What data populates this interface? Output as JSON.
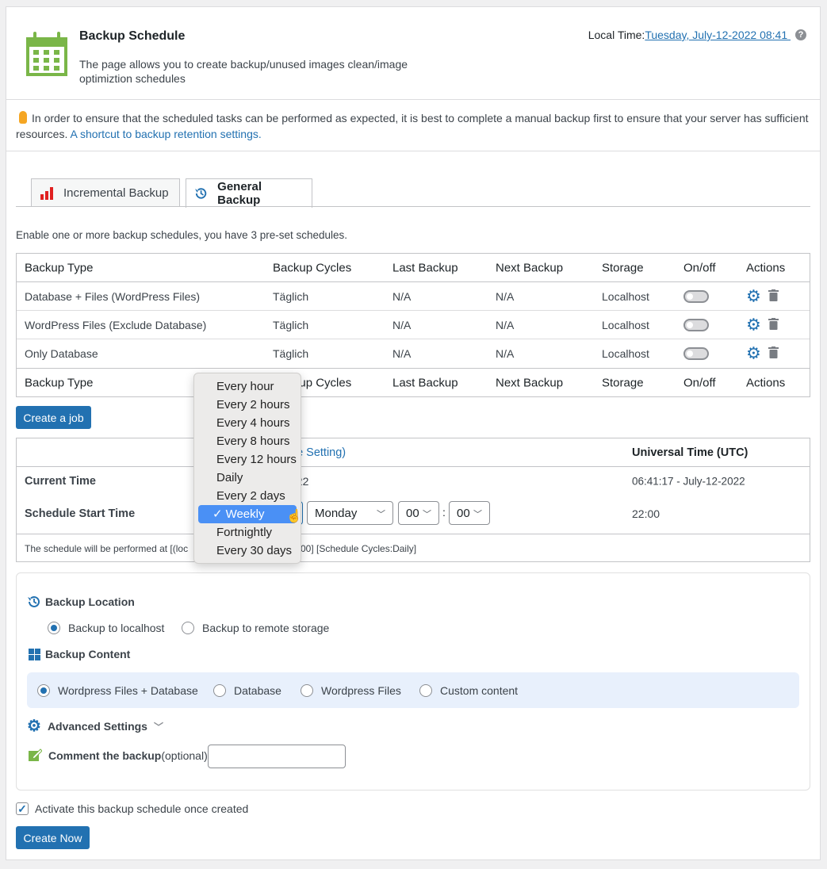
{
  "header": {
    "title": "Backup Schedule",
    "description_line1": "The page allows you to create backup/unused images clean/image",
    "description_line2": "optimiztion schedules",
    "local_time_label": "Local Time: ",
    "local_time_value": "Tuesday, July-12-2022 08:41 ",
    "help_icon": "?"
  },
  "notice": {
    "text": "In order to ensure that the scheduled tasks can be performed as expected, it is best to complete a manual backup first to ensure that your server has sufficient resources. ",
    "link": "A shortcut to backup retention settings."
  },
  "tabs": [
    {
      "label": "Incremental Backup",
      "icon": "bar-chart-icon"
    },
    {
      "label": "General Backup",
      "icon": "history-icon",
      "active": true
    }
  ],
  "intro": "Enable one or more backup schedules, you have 3 pre-set schedules.",
  "schedules_table": {
    "columns": [
      "Backup Type",
      "Backup Cycles",
      "Last Backup",
      "Next Backup",
      "Storage",
      "On/off",
      "Actions"
    ],
    "rows": [
      {
        "type": "Database + Files (WordPress Files)",
        "cycle": "Täglich",
        "last": "N/A",
        "next": "N/A",
        "storage": "Localhost",
        "on": false
      },
      {
        "type": "WordPress Files (Exclude Database)",
        "cycle": "Täglich",
        "last": "N/A",
        "next": "N/A",
        "storage": "Localhost",
        "on": false
      },
      {
        "type": "Only Database",
        "cycle": "Täglich",
        "last": "N/A",
        "next": "N/A",
        "storage": "Localhost",
        "on": false
      }
    ]
  },
  "create_job": "Create a job",
  "time_table": {
    "local_header_fragment": "ne Setting)",
    "utc_header": "Universal Time (UTC)",
    "current_time_label": "Current Time",
    "current_local_fragment": "022",
    "current_utc": "06:41:17 - July-12-2022",
    "start_label": "Schedule Start Time",
    "day": "Monday",
    "hour": "00",
    "minute": "00",
    "separator": ":",
    "utc_start": "22:00",
    "note_start": "The schedule will be performed at [(loc",
    "note_end": "00] [Schedule Cycles:Daily]"
  },
  "cycle_dropdown": {
    "options": [
      "Every hour",
      "Every 2 hours",
      "Every 4 hours",
      "Every 8 hours",
      "Every 12 hours",
      "Daily",
      "Every 2 days",
      "Weekly",
      "Fortnightly",
      "Every 30 days"
    ],
    "selected": "Weekly",
    "check": "✓"
  },
  "settings": {
    "location_title": "Backup Location",
    "location_options": [
      "Backup to localhost",
      "Backup to remote storage"
    ],
    "location_selected": "Backup to localhost",
    "content_title": "Backup Content",
    "content_options": [
      "Wordpress Files + Database",
      "Database",
      "Wordpress Files",
      "Custom content"
    ],
    "content_selected": "Wordpress Files + Database",
    "advanced_title": "Advanced Settings",
    "comment_label": "Comment the backup",
    "comment_optional": "(optional):",
    "comment_value": ""
  },
  "activate_label": "Activate this backup schedule once created",
  "activate_checked": true,
  "create_now": "Create Now",
  "colors": {
    "accent": "#2271b1",
    "green": "#7ab648",
    "bar_red": "#e02020",
    "highlight": "#4a90f5"
  }
}
